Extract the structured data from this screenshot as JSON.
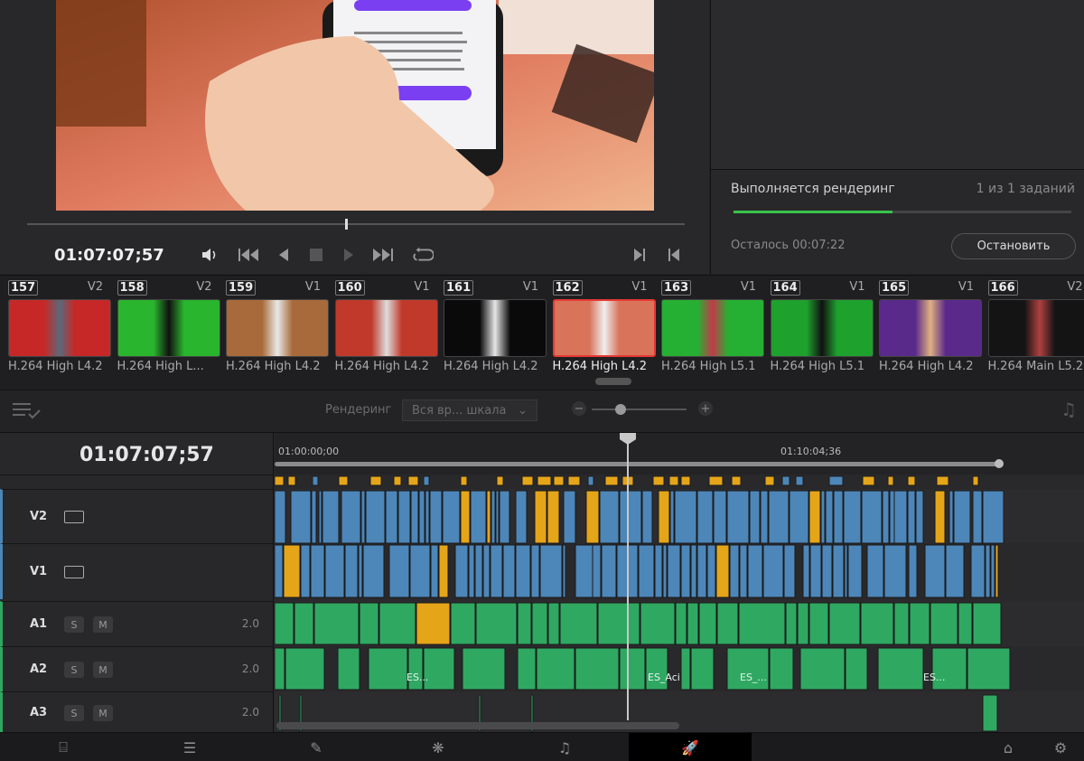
{
  "viewer": {
    "timecode": "01:07:07;57"
  },
  "icons": {
    "volume": "volume-icon",
    "prev": "skip-back-icon",
    "step_back": "step-back-icon",
    "stop": "stop-icon",
    "play": "play-icon",
    "next": "skip-forward-icon",
    "loop": "loop-icon",
    "first_frame": "first-frame-icon",
    "last_frame": "last-frame-icon"
  },
  "render_panel": {
    "title": "Выполняется рендеринг",
    "count": "1 из 1 заданий",
    "progress": 0.47,
    "remaining": "Осталось 00:07:22",
    "stop_label": "Остановить",
    "progress_color": "#39c24a"
  },
  "clips": [
    {
      "num": "157",
      "track": "V2",
      "codec": "H.264 High L4.2",
      "colors": [
        "#c62828",
        "#5a6a7a"
      ]
    },
    {
      "num": "158",
      "track": "V2",
      "codec": "H.264 High L...",
      "colors": [
        "#29b52d",
        "#111"
      ]
    },
    {
      "num": "159",
      "track": "V1",
      "codec": "H.264 High L4.2",
      "colors": [
        "#a86a3a",
        "#e8e8e8"
      ]
    },
    {
      "num": "160",
      "track": "V1",
      "codec": "H.264 High L4.2",
      "colors": [
        "#c0392b",
        "#ddd"
      ]
    },
    {
      "num": "161",
      "track": "V1",
      "codec": "H.264 High L4.2",
      "colors": [
        "#0a0a0a",
        "#e6e6e6"
      ]
    },
    {
      "num": "162",
      "track": "V1",
      "codec": "H.264 High L4.2",
      "colors": [
        "#d9735a",
        "#eee"
      ],
      "selected": true
    },
    {
      "num": "163",
      "track": "V1",
      "codec": "H.264 High L5.1",
      "colors": [
        "#26b033",
        "#c23a4a"
      ]
    },
    {
      "num": "164",
      "track": "V1",
      "codec": "H.264 High L5.1",
      "colors": [
        "#1fa12e",
        "#111"
      ]
    },
    {
      "num": "165",
      "track": "V1",
      "codec": "H.264 High L4.2",
      "colors": [
        "#5a2a8a",
        "#e0b080"
      ]
    },
    {
      "num": "166",
      "track": "V2",
      "codec": "H.264 Main L5.2",
      "colors": [
        "#141414",
        "#b04040"
      ]
    }
  ],
  "toolbar": {
    "render_label": "Рендеринг",
    "range_value": "Вся вр... шкала",
    "zoom_level": 0.3
  },
  "timeline": {
    "timecode": "01:07:07;57",
    "ruler_labels": [
      "01:00:00;00",
      "01:10:04;36"
    ],
    "tracks": [
      {
        "name": "V2",
        "type": "video"
      },
      {
        "name": "V1",
        "type": "video"
      },
      {
        "name": "A1",
        "type": "audio",
        "s": "S",
        "m": "M",
        "vol": "2.0"
      },
      {
        "name": "A2",
        "type": "audio",
        "s": "S",
        "m": "M",
        "vol": "2.0"
      },
      {
        "name": "A3",
        "type": "audio",
        "s": "S",
        "m": "M",
        "vol": "2.0"
      }
    ],
    "audio_clip_labels": [
      "ES...",
      "ES_Aci",
      "ES_...",
      "ES..."
    ],
    "colors": {
      "video": "#4d86b8",
      "video_alt": "#e5a519",
      "audio": "#2fa862",
      "audio_alt": "#e5a519"
    }
  },
  "bottom_nav": [
    {
      "icon": "media-page-icon",
      "glyph": "⌸"
    },
    {
      "icon": "edit-page-icon",
      "glyph": "☰"
    },
    {
      "icon": "fusion-page-icon",
      "glyph": "✎"
    },
    {
      "icon": "color-page-icon",
      "glyph": "❋"
    },
    {
      "icon": "fairlight-page-icon",
      "glyph": "♫"
    },
    {
      "icon": "deliver-page-icon",
      "glyph": "🚀",
      "active": true
    },
    {
      "icon": "home-icon",
      "glyph": "⌂"
    },
    {
      "icon": "settings-icon",
      "glyph": "⚙"
    }
  ]
}
